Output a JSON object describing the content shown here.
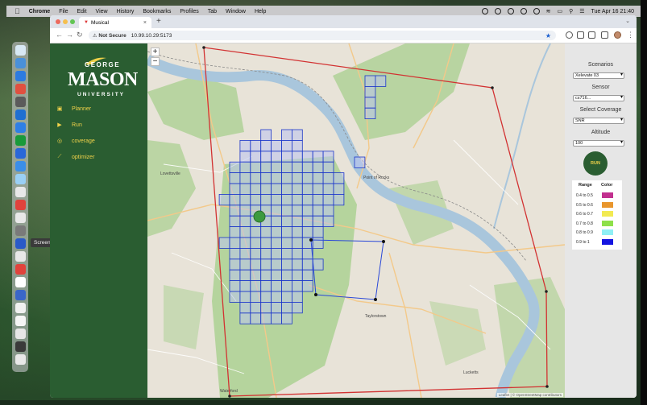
{
  "menubar": {
    "app": "Chrome",
    "items": [
      "File",
      "Edit",
      "View",
      "History",
      "Bookmarks",
      "Profiles",
      "Tab",
      "Window",
      "Help"
    ],
    "clock": "Tue Apr 16  21:40"
  },
  "dock": {
    "tooltip": "Screenshot",
    "icon_colors": [
      "#d8e8f4",
      "#4a90d9",
      "#2d7be0",
      "#e05040",
      "#5b5b5b",
      "#1f6fd1",
      "#2f7fe6",
      "#1a9a3a",
      "#2a67d8",
      "#3a8ee8",
      "#9ad0f5",
      "#e8e8e8",
      "#e0423c",
      "#e8e8e8",
      "#7a7a7a",
      "#2a5ac8",
      "#e8e8e8",
      "#e0433c",
      "#ffffff",
      "#3a66c8",
      "#f0f0f0",
      "#f5f5f5",
      "#e6e6e6",
      "#3a3a3a",
      "#e8e8e8"
    ]
  },
  "browser": {
    "tab_title": "Musical",
    "url_security": "Not Secure",
    "url": "10.99.10.29:5173"
  },
  "sidebar": {
    "logo": {
      "line1": "GEORGE",
      "line2": "MASON",
      "line3": "UNIVERSITY"
    },
    "nav": [
      {
        "label": "Planner",
        "icon": "map-icon"
      },
      {
        "label": "Run",
        "icon": "play-icon"
      },
      {
        "label": "coverage",
        "icon": "target-icon"
      },
      {
        "label": "optimizer",
        "icon": "chart-icon"
      }
    ]
  },
  "map": {
    "zoom_in": "+",
    "zoom_out": "−",
    "attribution": "Leaflet | © OpenStreetMap contributors",
    "colors": {
      "water": "#a9c6dc",
      "land": "#e8e3d8",
      "forest": "#a8cf8f",
      "grid_fill": "#b9c3f0",
      "grid_line": "#1b36c9",
      "boundary": "#d23232"
    },
    "place_labels": [
      "Lovettsville",
      "Waterford",
      "Point of Rocks",
      "Taylorstown",
      "Lucketts"
    ]
  },
  "panel": {
    "scenarios_label": "Scenarios",
    "scenario_value": "Xelevate 03",
    "sensor_label": "Sensor",
    "sensor_value": "cs716...",
    "coverage_label": "Select Coverage",
    "coverage_value": "SNR",
    "altitude_label": "Altitude",
    "altitude_value": "100",
    "run_label": "RUN",
    "legend": {
      "range_header": "Range",
      "color_header": "Color",
      "rows": [
        {
          "range": "0.4 to 0.5",
          "color": "#c2308f"
        },
        {
          "range": "0.5 to 0.6",
          "color": "#e9962d"
        },
        {
          "range": "0.6 to 0.7",
          "color": "#f2ea52"
        },
        {
          "range": "0.7 to 0.8",
          "color": "#8ee04a"
        },
        {
          "range": "0.8 to 0.9",
          "color": "#8ff0f5"
        },
        {
          "range": "0.9 to 1",
          "color": "#1414e0"
        }
      ]
    }
  }
}
